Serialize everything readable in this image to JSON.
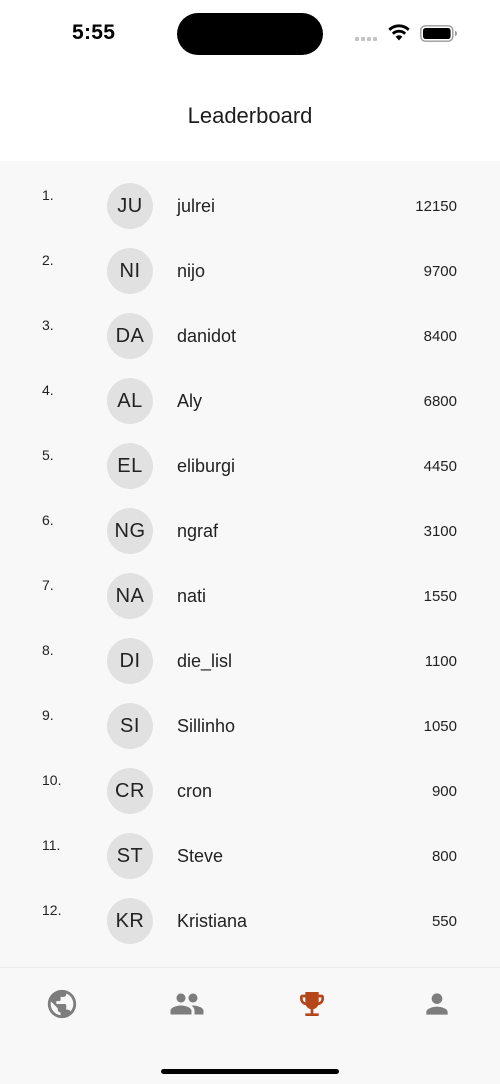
{
  "status_bar": {
    "time": "5:55"
  },
  "header": {
    "title": "Leaderboard"
  },
  "leaderboard": [
    {
      "rank": "1.",
      "initials": "JU",
      "name": "julrei",
      "score": "12150"
    },
    {
      "rank": "2.",
      "initials": "NI",
      "name": "nijo",
      "score": "9700"
    },
    {
      "rank": "3.",
      "initials": "DA",
      "name": "danidot",
      "score": "8400"
    },
    {
      "rank": "4.",
      "initials": "AL",
      "name": "Aly",
      "score": "6800"
    },
    {
      "rank": "5.",
      "initials": "EL",
      "name": "eliburgi",
      "score": "4450"
    },
    {
      "rank": "6.",
      "initials": "NG",
      "name": "ngraf",
      "score": "3100"
    },
    {
      "rank": "7.",
      "initials": "NA",
      "name": "nati",
      "score": "1550"
    },
    {
      "rank": "8.",
      "initials": "DI",
      "name": "die_lisl",
      "score": "1100"
    },
    {
      "rank": "9.",
      "initials": "SI",
      "name": "Sillinho",
      "score": "1050"
    },
    {
      "rank": "10.",
      "initials": "CR",
      "name": "cron",
      "score": "900"
    },
    {
      "rank": "11.",
      "initials": "ST",
      "name": "Steve",
      "score": "800"
    },
    {
      "rank": "12.",
      "initials": "KR",
      "name": "Kristiana",
      "score": "550"
    }
  ],
  "bottom_nav": {
    "items": [
      {
        "icon": "globe-icon",
        "active": false
      },
      {
        "icon": "friends-icon",
        "active": false
      },
      {
        "icon": "trophy-icon",
        "active": true
      },
      {
        "icon": "profile-icon",
        "active": false
      }
    ]
  },
  "colors": {
    "accent": "#b5461b",
    "nav_inactive": "#7d7d7d",
    "avatar_bg": "#e1e1e1",
    "list_bg": "#f8f8f8"
  }
}
